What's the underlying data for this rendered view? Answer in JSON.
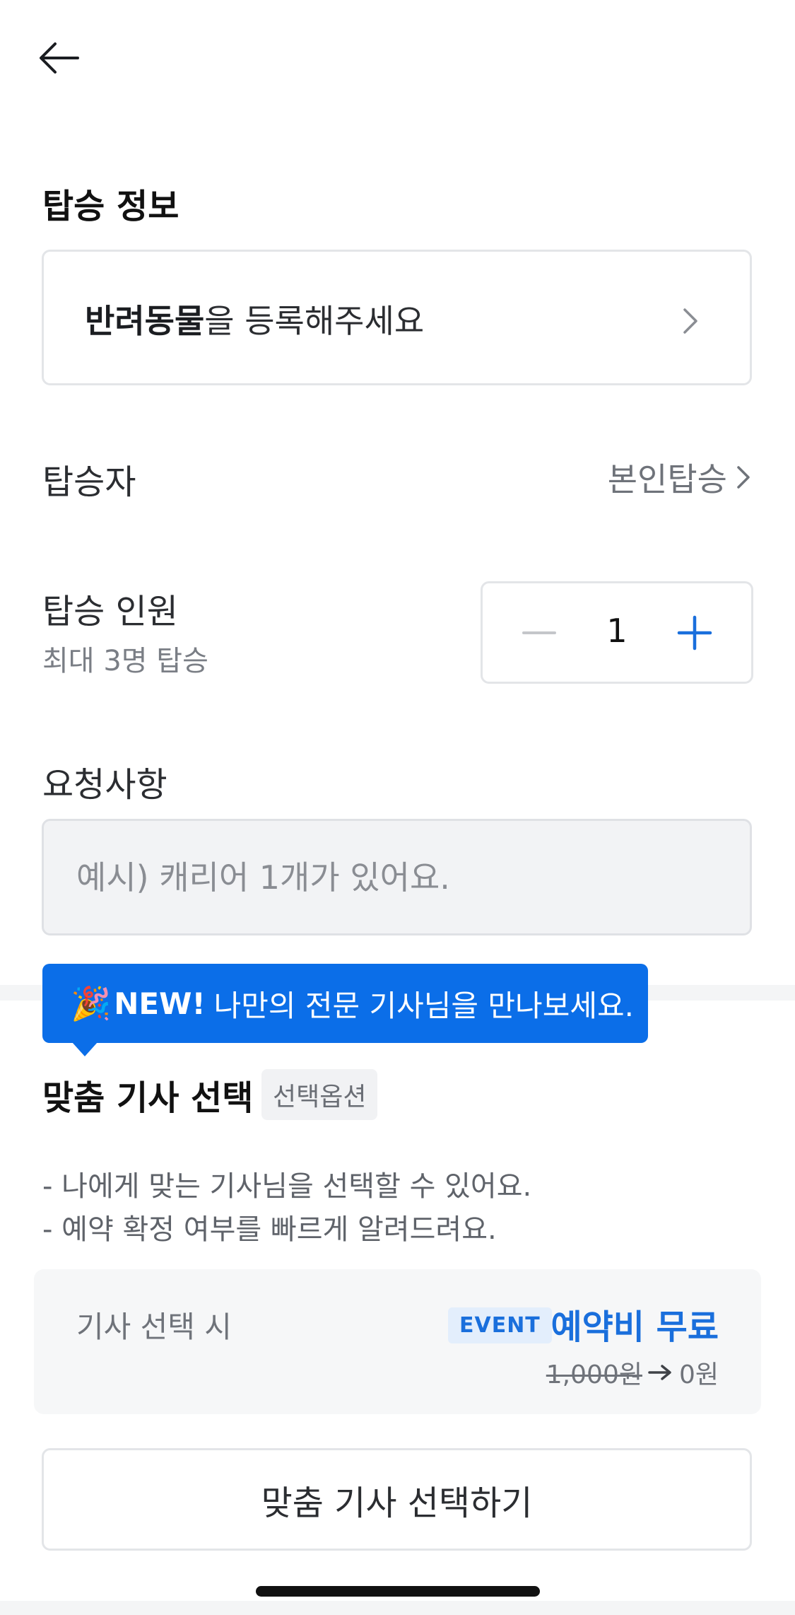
{
  "header": {
    "back_icon": "arrow-left-icon"
  },
  "boarding_info": {
    "title": "탑승 정보",
    "pet_prompt_bold": "반려동물",
    "pet_prompt_rest": "을 등록해주세요",
    "pet_chevron_icon": "chevron-right-icon"
  },
  "passenger": {
    "label": "탑승자",
    "value": "본인탑승",
    "chevron_icon": "chevron-right-icon"
  },
  "passenger_count": {
    "label": "탑승 인원",
    "sublabel": "최대 3명 탑승",
    "value": "1",
    "minus_icon": "minus-icon",
    "plus_icon": "plus-icon"
  },
  "request": {
    "label": "요청사항",
    "placeholder": "예시) 캐리어 1개가 있어요."
  },
  "tooltip": {
    "emoji": "🎉",
    "new_label": "NEW!",
    "message": "나만의 전문 기사님을 만나보세요."
  },
  "driver_select": {
    "title": "맞춤 기사 선택",
    "badge": "선택옵션",
    "desc_1": "- 나에게 맞는 기사님을 선택할 수 있어요.",
    "desc_2": "- 예약 확정 여부를 빠르게 알려드려요.",
    "fee_label": "기사 선택 시",
    "event_badge": "EVENT",
    "free_text": "예약비 무료",
    "old_price": "1,000원",
    "new_price": "0원",
    "button_label": "맞춤 기사 선택하기"
  },
  "colors": {
    "accent": "#0b6ee8",
    "event_text": "#1a6fdc",
    "border": "#e3e5e8"
  }
}
